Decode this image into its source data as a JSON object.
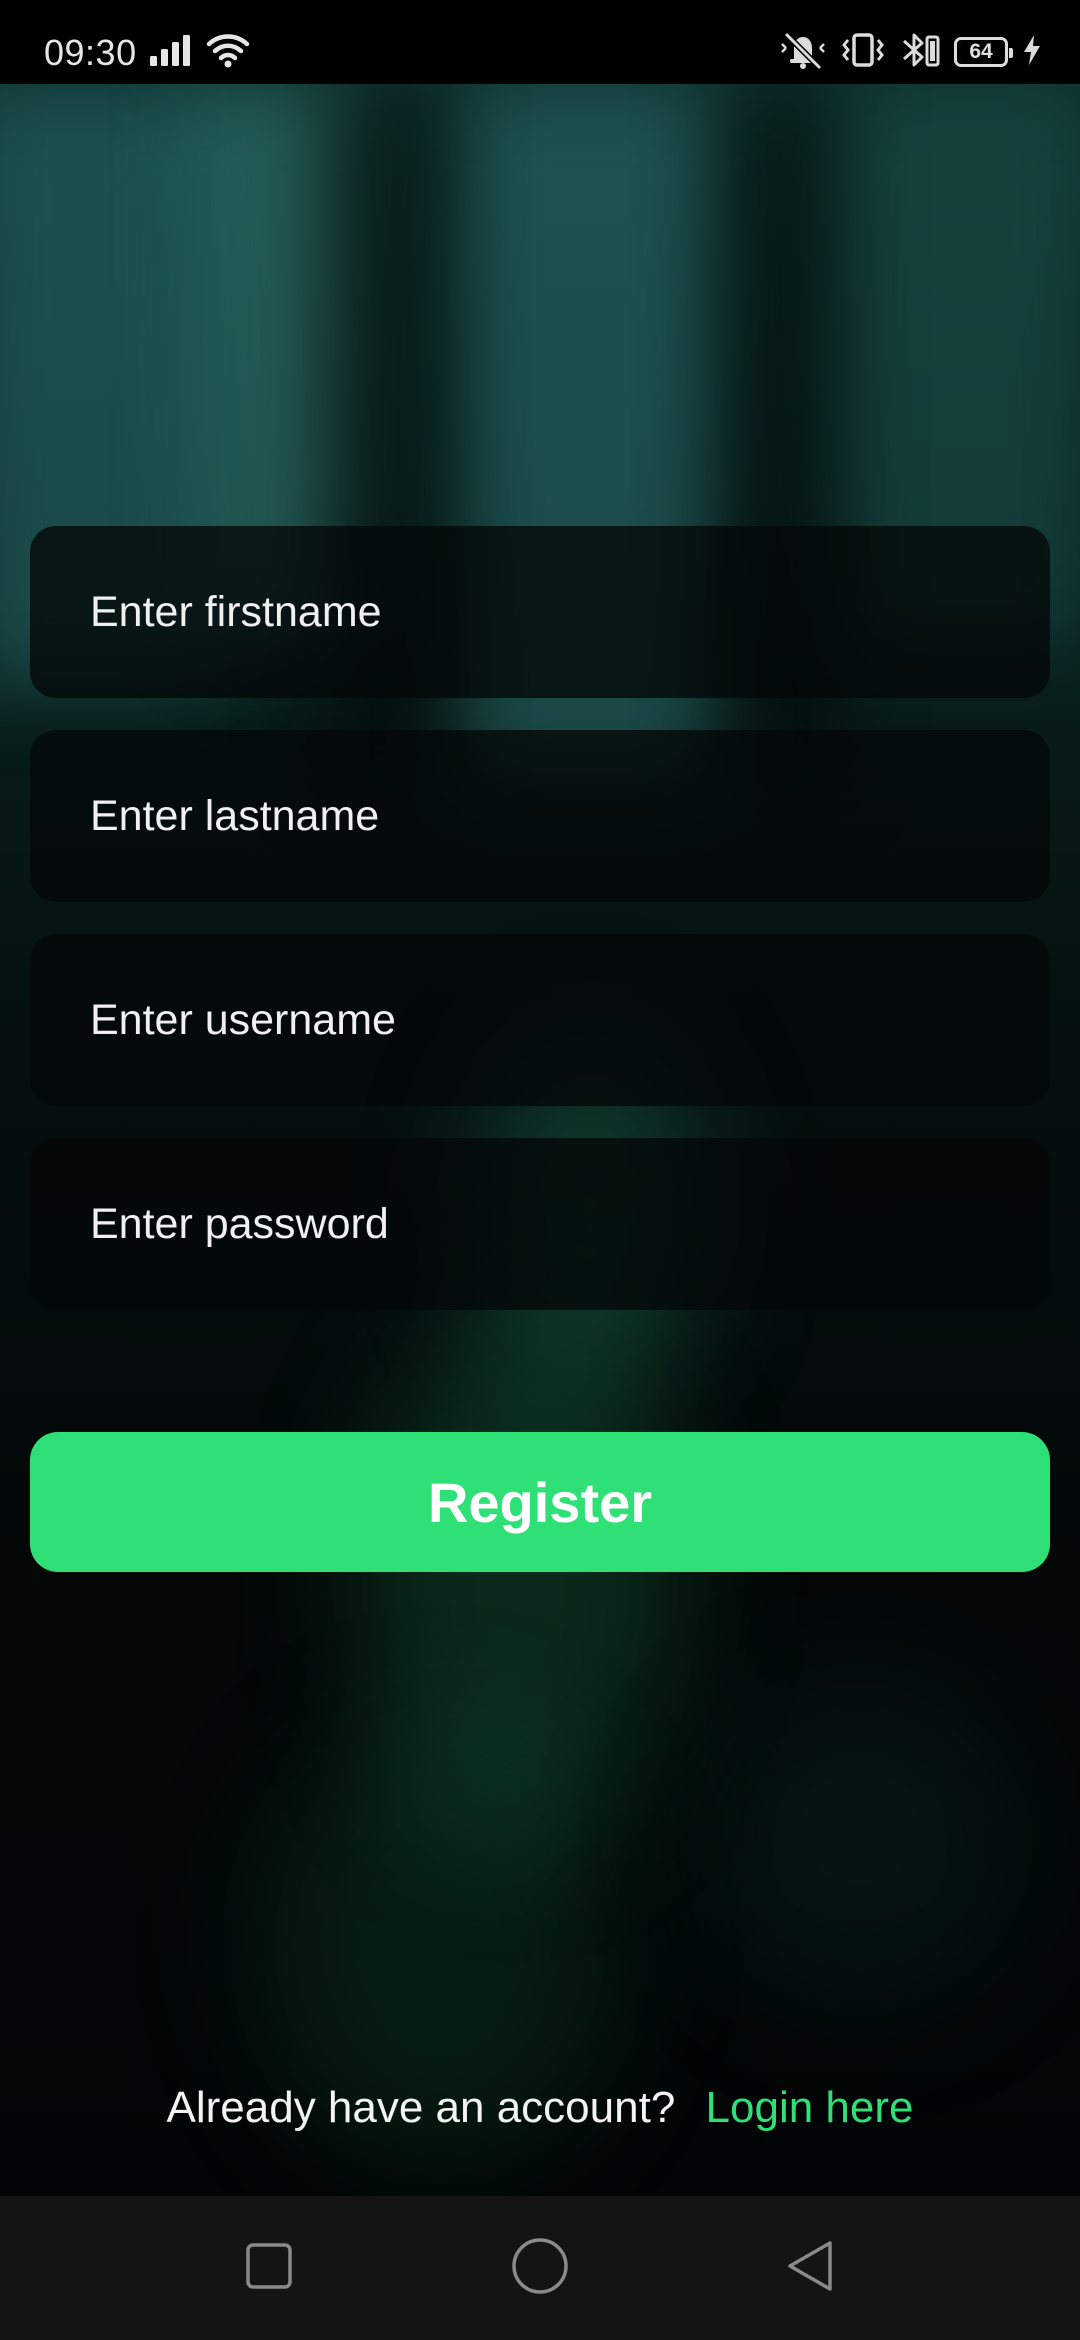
{
  "status_bar": {
    "time": "09:30",
    "battery_level": "64",
    "icons": [
      "signal-icon",
      "wifi-icon",
      "mute-icon",
      "vibrate-icon",
      "bluetooth-icon",
      "battery-icon",
      "charging-icon"
    ]
  },
  "form": {
    "firstname_placeholder": "Enter firstname",
    "lastname_placeholder": "Enter lastname",
    "username_placeholder": "Enter username",
    "password_placeholder": "Enter password",
    "firstname_value": "",
    "lastname_value": "",
    "username_value": "",
    "password_value": "",
    "register_label": "Register"
  },
  "footer": {
    "prompt": "Already have an account?",
    "login_link": "Login here"
  },
  "nav_bar": {
    "icons": [
      "recents-square-icon",
      "home-circle-icon",
      "back-triangle-icon"
    ]
  },
  "colors": {
    "accent": "#2fe077",
    "field_bg": "#050908",
    "nav_bg": "#141414",
    "status_bg": "#000000"
  }
}
